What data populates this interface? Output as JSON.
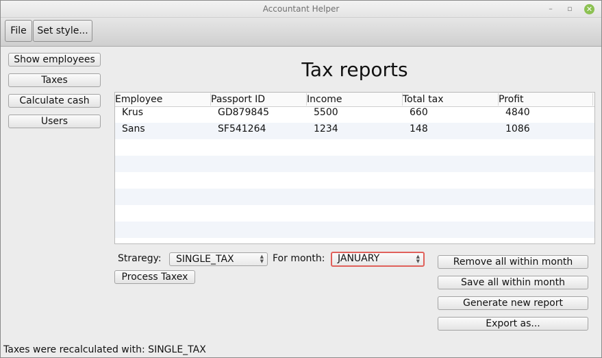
{
  "window": {
    "title": "Accountant Helper"
  },
  "titlebar_icons": {
    "minimize": "minimize-icon",
    "maximize": "maximize-icon",
    "close": "close-icon"
  },
  "toolbar": {
    "file_label": "File",
    "style_label": "Set style..."
  },
  "sidebar": {
    "items": [
      {
        "label": "Show employees"
      },
      {
        "label": "Taxes"
      },
      {
        "label": "Calculate cash"
      },
      {
        "label": "Users"
      }
    ]
  },
  "main": {
    "heading": "Tax reports",
    "table": {
      "columns": [
        "Employee",
        "Passport ID",
        "Income",
        "Total tax",
        "Profit"
      ],
      "rows": [
        [
          "Krus",
          "GD879845",
          "5500",
          "660",
          "4840"
        ],
        [
          "Sans",
          "SF541264",
          "1234",
          "148",
          "1086"
        ]
      ]
    },
    "strategy_label": "Straregy:",
    "strategy_value": "SINGLE_TAX",
    "month_label": "For month:",
    "month_value": "JANUARY",
    "process_label": "Process Taxex",
    "actions": {
      "remove": "Remove all within month",
      "save": "Save all within month",
      "generate": "Generate new report",
      "export": "Export as..."
    }
  },
  "status": "Taxes were recalculated with: SINGLE_TAX",
  "colors": {
    "focus_border": "#e0605a",
    "close_button": "#8cc152",
    "row_alt": "#f2f5fa"
  }
}
